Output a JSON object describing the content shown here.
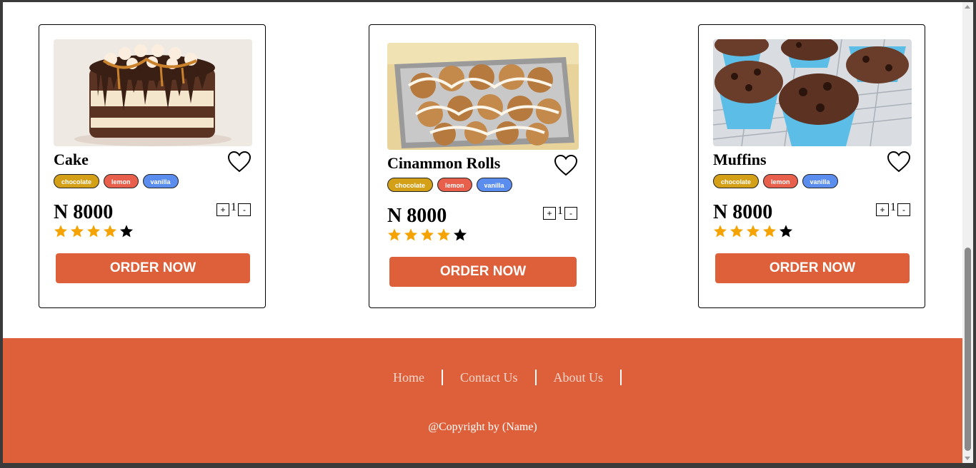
{
  "products": [
    {
      "name": "Cake",
      "tags": [
        "chocolate",
        "lemon",
        "vanilla"
      ],
      "price": "N 8000",
      "quantity": "1",
      "qty_plus": "+",
      "qty_minus": "-",
      "rating": 4,
      "rating_max": 5,
      "order_label": "ORDER NOW",
      "image_icon": "cake-image"
    },
    {
      "name": "Cinammon Rolls",
      "tags": [
        "chocolate",
        "lemon",
        "vanilla"
      ],
      "price": "N 8000",
      "quantity": "1",
      "qty_plus": "+",
      "qty_minus": "-",
      "rating": 4,
      "rating_max": 5,
      "order_label": "ORDER NOW",
      "image_icon": "cinnamon-rolls-image"
    },
    {
      "name": "Muffins",
      "tags": [
        "chocolate",
        "lemon",
        "vanilla"
      ],
      "price": "N 8000",
      "quantity": "1",
      "qty_plus": "+",
      "qty_minus": "-",
      "rating": 4,
      "rating_max": 5,
      "order_label": "ORDER NOW",
      "image_icon": "muffins-image"
    }
  ],
  "tag_colors": {
    "chocolate": "#d4a017",
    "lemon": "#e8604c",
    "vanilla": "#5b8def"
  },
  "colors": {
    "accent": "#dd603a",
    "star_filled": "#f5a300",
    "star_empty": "#000000"
  },
  "footer": {
    "nav": [
      "Home",
      "Contact Us",
      "About Us"
    ],
    "copyright": "@Copyright by (Name)"
  }
}
